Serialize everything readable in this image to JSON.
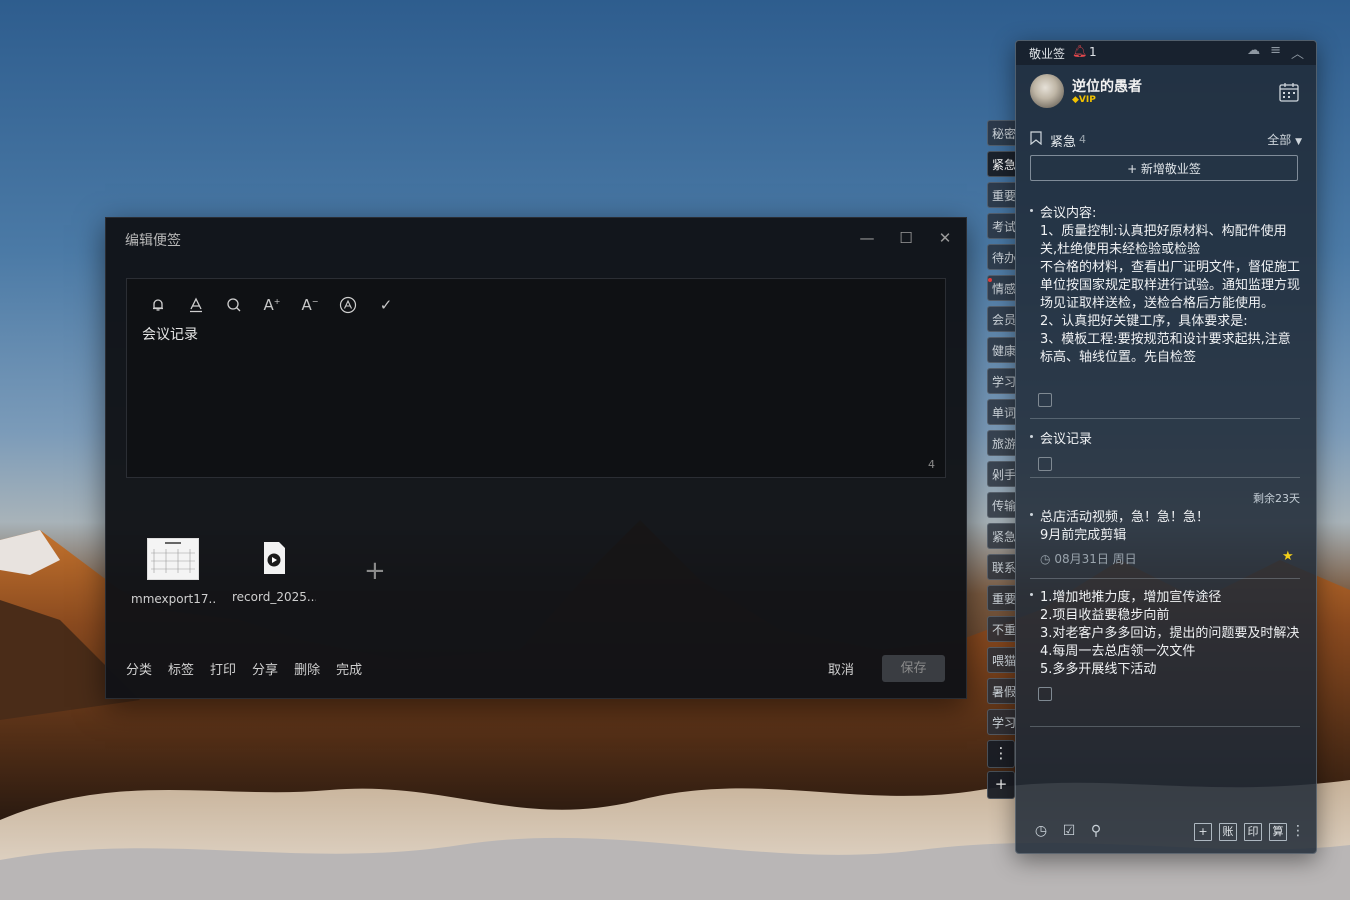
{
  "editor": {
    "title": "编辑便签",
    "content": "会议记录",
    "char_count": "4",
    "attachments": [
      {
        "name": "mmexport17...",
        "type": "image"
      },
      {
        "name": "record_2025...",
        "type": "audio"
      }
    ],
    "actions": [
      "分类",
      "标签",
      "打印",
      "分享",
      "删除",
      "完成"
    ],
    "cancel_label": "取消",
    "save_label": "保存",
    "toolbar_icons": [
      "bell-icon",
      "text-color-icon",
      "search-icon",
      "font-increase-icon",
      "font-decrease-icon",
      "ocr-icon",
      "check-icon"
    ]
  },
  "tabs": [
    "秘密",
    "紧急",
    "重要",
    "考试",
    "待办",
    "情感",
    "会员",
    "健康",
    "学习",
    "单词",
    "旅游",
    "剁手",
    "传输",
    "紧急",
    "联系",
    "重要",
    "不重",
    "喂猫",
    "暑假",
    "学习"
  ],
  "panel": {
    "app_name": "敬业签",
    "alert_count": "1",
    "username": "逆位的愚者",
    "vip_label": "VIP",
    "group_name": "紧急",
    "group_count": "4",
    "filter_label": "全部",
    "new_note_label": "+ 新增敬业签",
    "notes": [
      {
        "text": "会议内容:\n1、质量控制:认真把好原材料、构配件使用关,杜绝使用未经检验或检验\n不合格的材料，查看出厂证明文件，督促施工单位按国家规定取样进行试验。通知监理方现场见证取样送检，送检合格后方能使用。\n2、认真把好关键工序，具体要求是:\n3、模板工程:要按规范和设计要求起拱,注意标高、轴线位置。先自检签"
      },
      {
        "text": "会议记录"
      },
      {
        "text": "总店活动视频，急！急！急！\n9月前完成剪辑",
        "remaining": "剩余23天",
        "date": "08月31日 周日"
      },
      {
        "text": "1.增加地推力度，增加宣传途径\n2.项目收益要稳步向前\n3.对老客户多多回访，提出的问题要及时解决\n4.每周一去总店领一次文件\n5.多多开展线下活动"
      }
    ],
    "footer_boxes": [
      "账",
      "印",
      "算"
    ]
  }
}
